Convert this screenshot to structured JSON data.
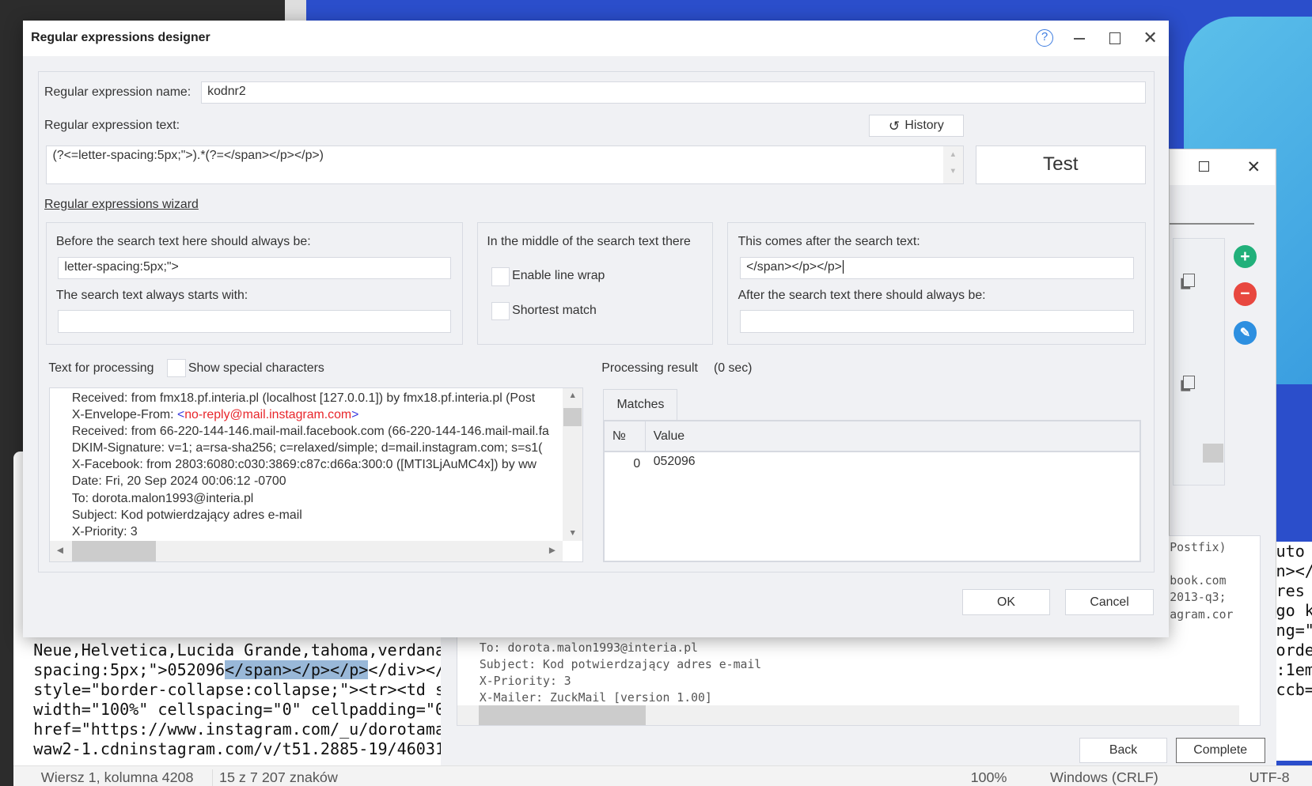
{
  "dialog": {
    "title": "Regular expressions designer",
    "name_label": "Regular expression name:",
    "name_value": "kodnr2",
    "text_label": "Regular expression text:",
    "history_label": "History",
    "regex_value": "(?<=letter-spacing:5px;\">).*(?=</span></p></p>)",
    "test_label": "Test",
    "wizard_link": "Regular expressions wizard",
    "before_label": "Before the search text here should always be:",
    "before_value": "letter-spacing:5px;\">",
    "starts_label": "The search text always starts with:",
    "starts_value": "",
    "middle_label": "In the middle of the search text there",
    "enable_wrap_label": "Enable line wrap",
    "shortest_label": "Shortest match",
    "after_label": "This comes after the search text:",
    "after_value": "</span></p></p>",
    "after_always_label": "After the search text there should always be:",
    "after_always_value": "",
    "text_processing_label": "Text for processing",
    "show_special_label": "Show special characters",
    "result_label": "Processing result",
    "result_time": "(0 sec)",
    "text_lines": [
      "Received: from fmx18.pf.interia.pl (localhost [127.0.0.1]) by fmx18.pf.interia.pl (Post",
      "X-Envelope-From: ",
      "Received: from 66-220-144-146.mail-mail.facebook.com (66-220-144-146.mail-mail.fa",
      "DKIM-Signature: v=1; a=rsa-sha256; c=relaxed/simple; d=mail.instagram.com; s=s1(",
      "X-Facebook: from 2803:6080:c030:3869:c87c:d66a:300:0 ([MTI3LjAuMC4x])    by ww",
      "Date: Fri, 20 Sep 2024 00:06:12 -0700",
      "To: dorota.malon1993@interia.pl",
      "Subject: Kod potwierdzający adres e-mail",
      "X-Priority: 3"
    ],
    "envelope_lt": "<",
    "envelope_user": "no-reply",
    "envelope_domain": "@mail.instagram.com",
    "envelope_gt": ">",
    "matches_tab": "Matches",
    "col_no": "№",
    "col_value": "Value",
    "rows": [
      {
        "no": "0",
        "value": "052096"
      }
    ],
    "ok_label": "OK",
    "cancel_label": "Cancel"
  },
  "bg_window": {
    "mono_lines": [
      "To: dorota.malon1993@interia.pl",
      "Subject: Kod potwierdzający adres e-mail",
      "X-Priority: 3",
      "X-Mailer: ZuckMail [version 1.00]"
    ],
    "right_lines": [
      "Postfix)",
      "",
      "book.com",
      "2013-q3;",
      "agram.cor"
    ],
    "back_label": "Back",
    "complete_label": "Complete"
  },
  "editor": {
    "lines": [
      "Neue,Helvetica,Lucida Grande,tahoma,verdana",
      "spacing:5px;\">052096",
      "style=\"border-collapse:collapse;\"><tr><td s",
      "width=\"100%\" cellspacing=\"0\" cellpadding=\"0",
      "href=\"https://www.instagram.com/_u/dorotama",
      "waw2-1.cdninstagram.com/v/t51.2885-19/46031"
    ],
    "highlight": "</span></p></p>",
    "after_highlight": "</div></",
    "right_lines": [
      "uto",
      "n></",
      "res",
      "go k",
      "",
      "",
      "ng=\"",
      "orde",
      ":1em",
      "",
      "ccb="
    ],
    "status_position": "Wiersz 1, kolumna 4208",
    "status_chars": "15 z 7 207 znaków",
    "status_zoom": "100%",
    "status_eol": "Windows (CRLF)",
    "status_enc": "UTF-8"
  },
  "colors": {
    "accent": "#2b4ecb",
    "link_red": "#e8262b",
    "add": "#21b07a",
    "remove": "#e8473f",
    "edit": "#2d8fe0"
  }
}
